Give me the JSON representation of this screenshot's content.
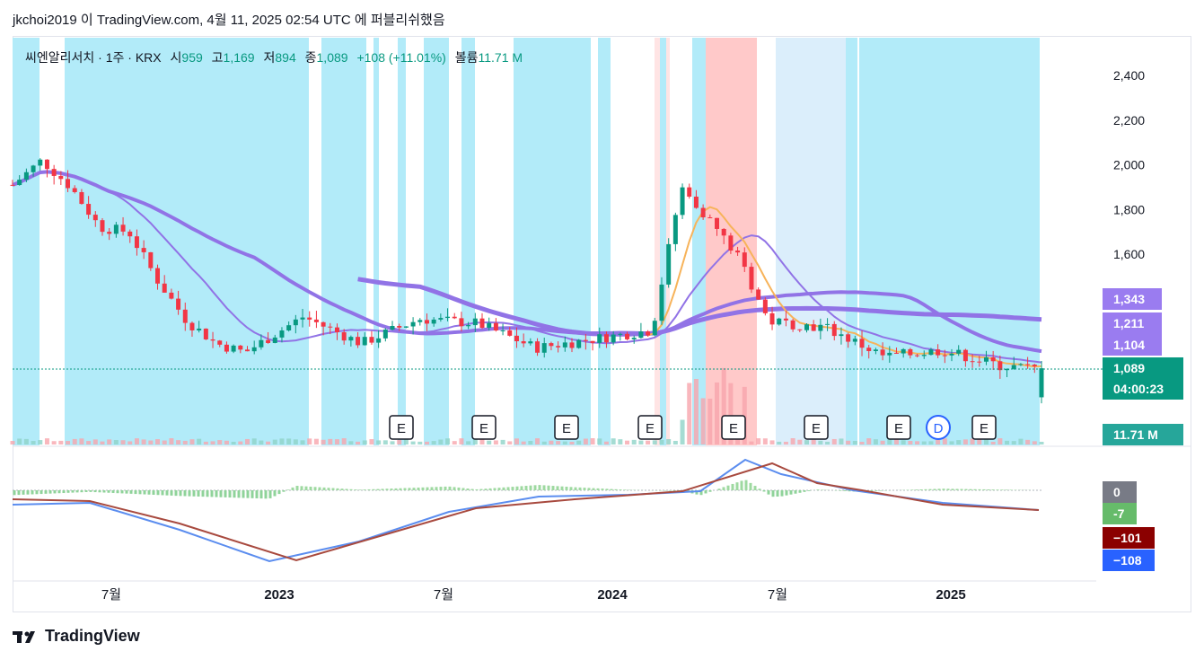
{
  "header": {
    "text": "jkchoi2019 이 TradingView.com, 4월 11, 2025 02:54 UTC 에 퍼블리쉬했음"
  },
  "legend": {
    "symbol": "씨엔알리서치 · 1주 · KRX",
    "open_label": "시",
    "open": "959",
    "high_label": "고",
    "high": "1,169",
    "low_label": "저",
    "low": "894",
    "close_label": "종",
    "close": "1,089",
    "change": "+108 (+11.01%)",
    "volume_label": "볼륨",
    "volume": "11.71 M"
  },
  "price_axis": {
    "ticks": [
      "2,400",
      "2,200",
      "2,000",
      "1,800",
      "1,600"
    ]
  },
  "price_badges": [
    {
      "text": "1,343",
      "color": "#9a7cf0"
    },
    {
      "text": "1,211",
      "color": "#9a7cf0"
    },
    {
      "text": "1,104",
      "color": "#9a7cf0"
    },
    {
      "text": "1,089",
      "color": "#089981"
    },
    {
      "text": "04:00:23",
      "color": "#089981"
    },
    {
      "text": "11.71 M",
      "color": "#26a69a"
    }
  ],
  "macd_badges": [
    {
      "text": "0",
      "color": "#787b86"
    },
    {
      "text": "-7",
      "color": "#66bb6a"
    },
    {
      "text": "−101",
      "color": "#8b0000"
    },
    {
      "text": "−108",
      "color": "#2962ff"
    }
  ],
  "time_axis": {
    "labels": [
      "7월",
      "2023",
      "7월",
      "2024",
      "7월",
      "2025"
    ]
  },
  "events": [
    "E",
    "E",
    "E",
    "E",
    "E",
    "E",
    "E",
    "D",
    "E"
  ],
  "footer": {
    "brand": "TradingView"
  },
  "colors": {
    "up": "#089981",
    "down": "#f23645",
    "cyan_band": "#b2ebf9",
    "red_band": "#ffc9c9",
    "ma_purple": "#9173e6",
    "macd_line": "#5b8def",
    "signal_line": "#a84a3f"
  },
  "chart_data": [
    {
      "type": "candlestick",
      "title": "씨엔알리서치 · 1주 · KRX",
      "x_range": [
        "2022-05",
        "2025-04"
      ],
      "ylim": [
        900,
        2450
      ],
      "y_ticks": [
        1600,
        1800,
        2000,
        2200,
        2400
      ],
      "last": {
        "open": 959,
        "high": 1169,
        "low": 894,
        "close": 1089,
        "change": 108,
        "change_pct": 11.01,
        "volume": "11.71 M"
      },
      "ma_last_values": [
        1343,
        1211,
        1104
      ],
      "close_series_approx": [
        {
          "x": "2022-05",
          "y": 1910
        },
        {
          "x": "2022-06",
          "y": 2020
        },
        {
          "x": "2022-07",
          "y": 1900
        },
        {
          "x": "2022-08",
          "y": 1720
        },
        {
          "x": "2022-09",
          "y": 1700
        },
        {
          "x": "2022-10",
          "y": 1480
        },
        {
          "x": "2022-11",
          "y": 1300
        },
        {
          "x": "2022-12",
          "y": 1200
        },
        {
          "x": "2023-01",
          "y": 1160
        },
        {
          "x": "2023-03",
          "y": 1320
        },
        {
          "x": "2023-05",
          "y": 1200
        },
        {
          "x": "2023-07",
          "y": 1310
        },
        {
          "x": "2023-09",
          "y": 1290
        },
        {
          "x": "2023-11",
          "y": 1180
        },
        {
          "x": "2024-01",
          "y": 1220
        },
        {
          "x": "2024-03",
          "y": 1260
        },
        {
          "x": "2024-04",
          "y": 1900
        },
        {
          "x": "2024-05",
          "y": 1750
        },
        {
          "x": "2024-06",
          "y": 1580
        },
        {
          "x": "2024-07",
          "y": 1300
        },
        {
          "x": "2024-09",
          "y": 1270
        },
        {
          "x": "2024-11",
          "y": 1140
        },
        {
          "x": "2025-01",
          "y": 1170
        },
        {
          "x": "2025-03",
          "y": 1100
        },
        {
          "x": "2025-04",
          "y": 1089
        }
      ]
    },
    {
      "type": "line",
      "title": "MACD",
      "series": [
        {
          "name": "",
          "values": [
            -101
          ]
        },
        {
          "name": "",
          "values": [
            -108
          ]
        }
      ],
      "histogram_last": -7,
      "zero_line": 0
    }
  ]
}
